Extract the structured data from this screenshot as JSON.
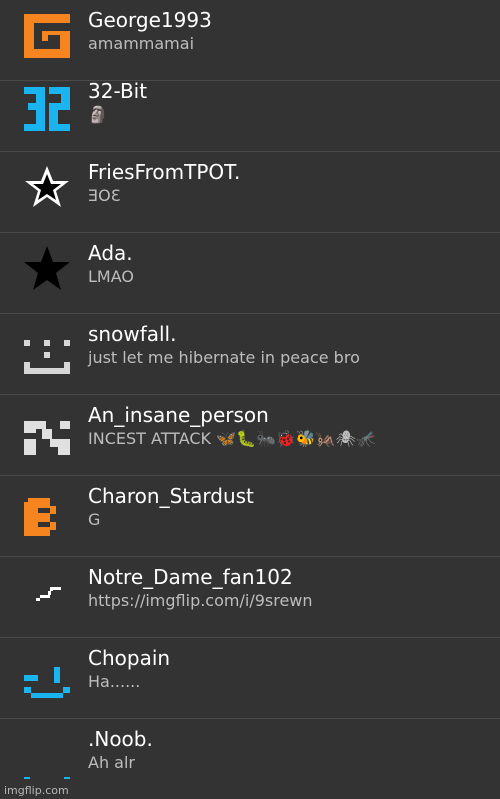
{
  "colors": {
    "background": "#333333",
    "divider": "#4a4a4a",
    "name_text": "#ffffff",
    "status_text": "#bdbdbd",
    "orange": "#f6851f",
    "blue": "#1ab4f0",
    "white": "#ffffff",
    "gray": "#d6d6d6"
  },
  "users": [
    {
      "name": "George1993",
      "status": "amammamai",
      "avatar_icon": "orange-g-logo-icon"
    },
    {
      "name": "32-Bit",
      "status": "🗿",
      "avatar_icon": "blue-32-logo-icon"
    },
    {
      "name": "FriesFromTPOT.",
      "status": "ƎՕƐ",
      "avatar_icon": "outlined-star-icon"
    },
    {
      "name": "Ada.",
      "status": "LMAO",
      "avatar_icon": "black-star-icon"
    },
    {
      "name": "snowfall.",
      "status": "just let me hibernate in peace bro",
      "avatar_icon": "white-pixel-face-icon"
    },
    {
      "name": "An_insane_person",
      "status": "INCEST ATTACK 🦋🐛🐜🐞🐝🦗🕷🦟",
      "avatar_icon": "checker-pixel-icon"
    },
    {
      "name": "Charon_Stardust",
      "status": "G",
      "avatar_icon": "orange-pixel-e-icon"
    },
    {
      "name": "Notre_Dame_fan102",
      "status": "https://imgflip.com/i/9srewn",
      "avatar_icon": "lightning-icon"
    },
    {
      "name": "Chopain",
      "status": "Ha......",
      "avatar_icon": "blue-pixel-smile-icon"
    },
    {
      "name": ".Noob.",
      "status": "Ah alr",
      "avatar_icon": "blue-pixel-dots-icon"
    }
  ],
  "watermark": "imgflip.com"
}
